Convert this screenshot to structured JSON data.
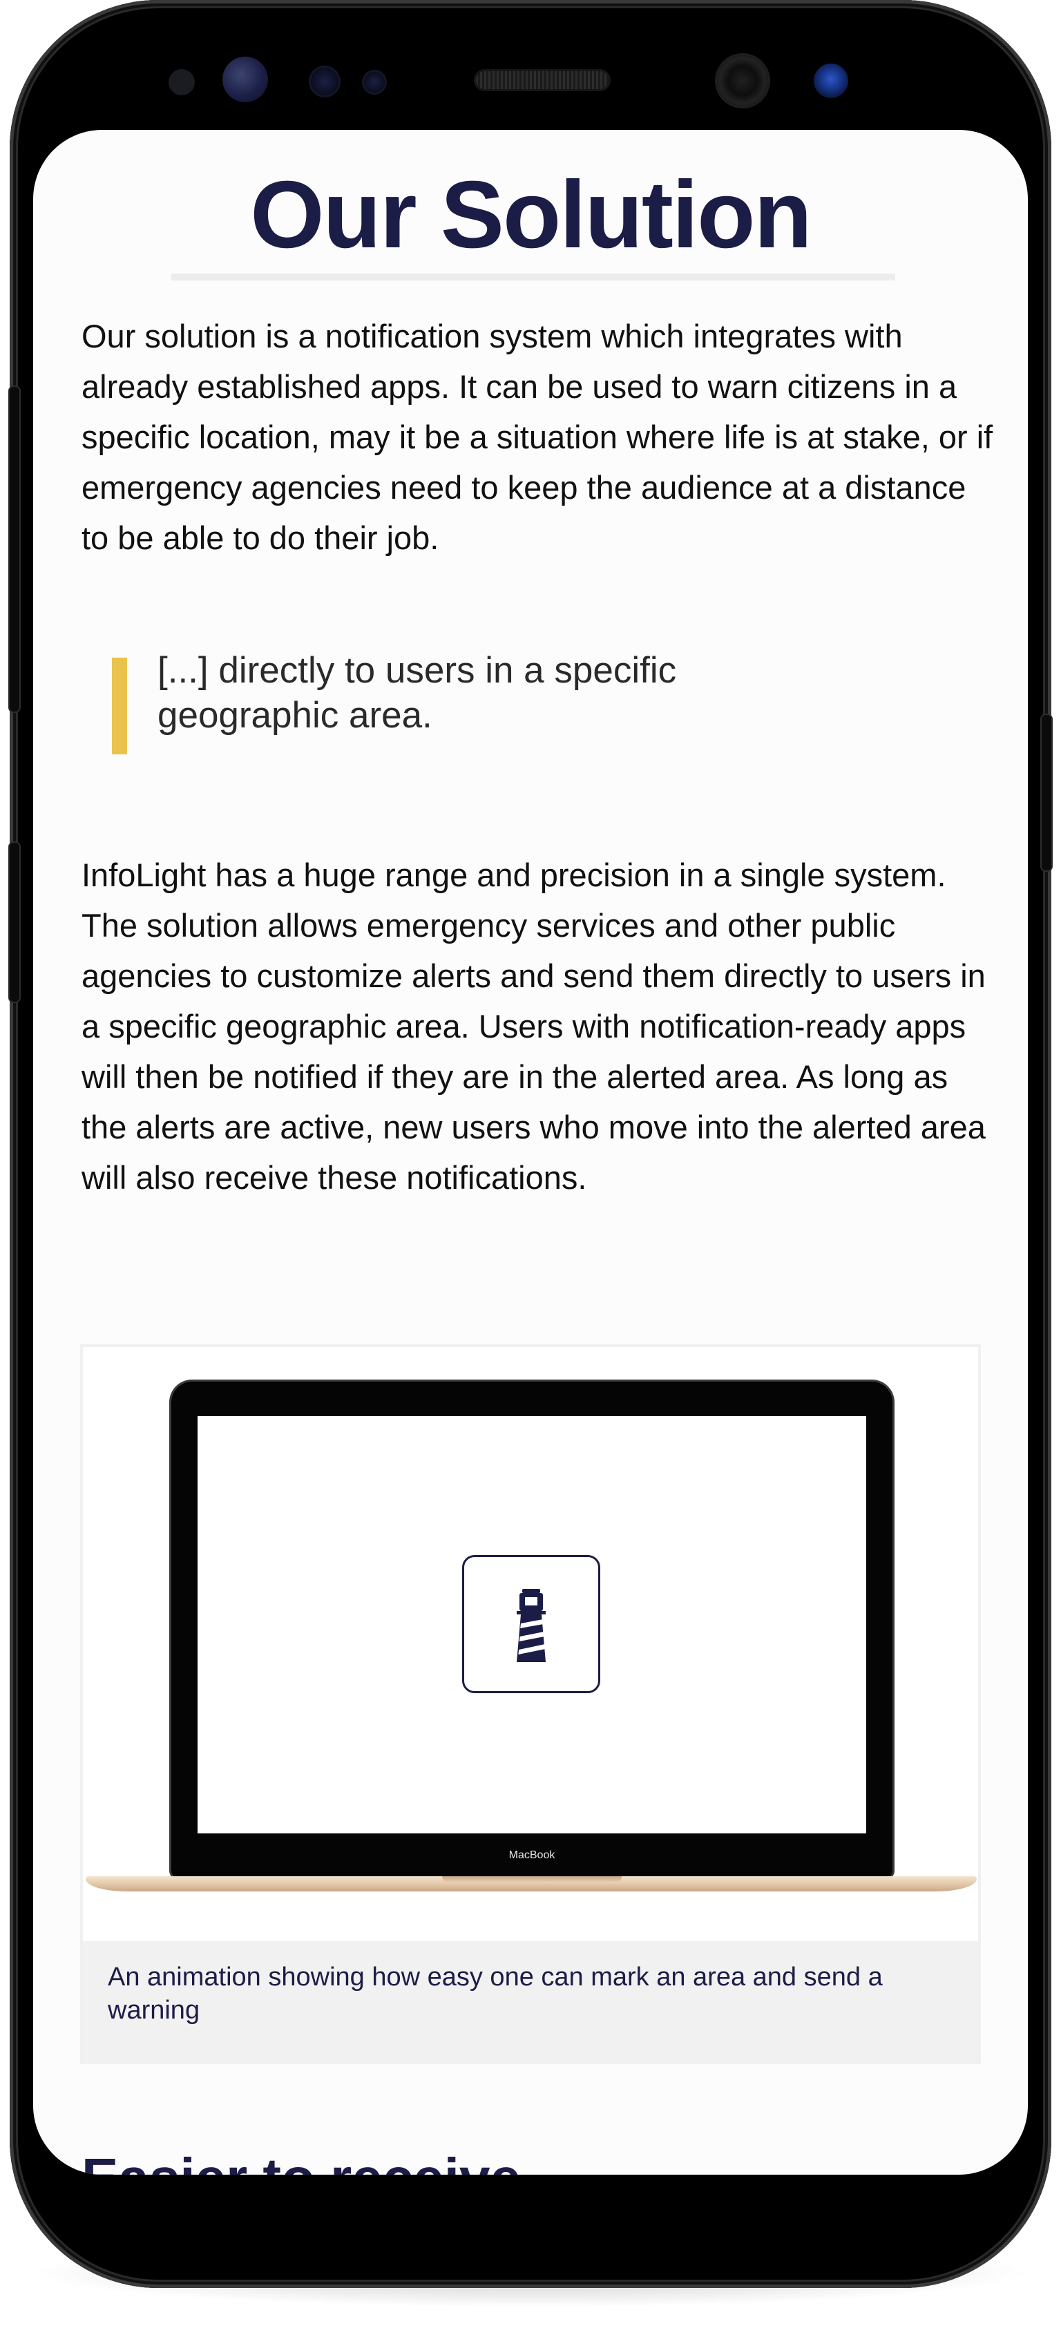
{
  "page": {
    "title": "Our Solution",
    "intro": "Our solution is a notification system which integrates with already established apps. It can be used to warn citizens in a specific location, may it be a situation where life is at stake, or if emergency agencies need to keep the audience at a distance to be able to do their job.",
    "quote": "[...] directly to users in a specific geographic area.",
    "body": "InfoLight has a huge range and precision in a single system. The solution allows emergency services and other public agencies to customize alerts and send them directly to users in a specific geographic area. Users with notification-ready apps will then be notified if they are in the alerted area. As long as the alerts are active, new users who move into the alerted area will also receive these notifications.",
    "figure": {
      "device_label": "MacBook",
      "app_icon": "lighthouse-icon",
      "caption": "An animation showing how easy one can mark an area and send a warning"
    },
    "next_heading": "Easier to receive"
  },
  "colors": {
    "heading": "#1c1d46",
    "quote_bar": "#e9c34b",
    "caption_bg": "#f1f1f1"
  }
}
